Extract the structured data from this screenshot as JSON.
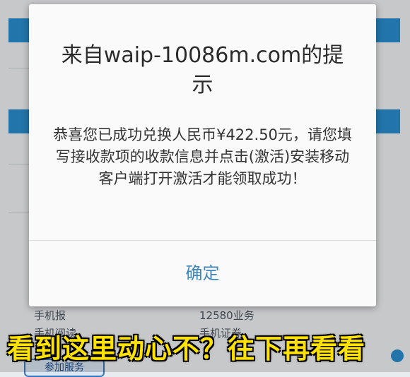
{
  "dialog": {
    "title": "来自waip-10086m.com的提示",
    "message": "恭喜您已成功兑换人民币¥422.50元，请您填写接收款项的收款信息并点击(激活)安装移动客户端打开激活才能领取成功！",
    "ok_label": "确定"
  },
  "background_page": {
    "links": [
      "手机报",
      "12580业务",
      "手机阅读",
      "手机证券"
    ],
    "button_label": "参加服务"
  },
  "caption": "看到这里动心不？往下再看看",
  "colors": {
    "dialog_button": "#3f87b8",
    "caption": "#ffe200",
    "bg_bar": "#2a8fd0"
  }
}
